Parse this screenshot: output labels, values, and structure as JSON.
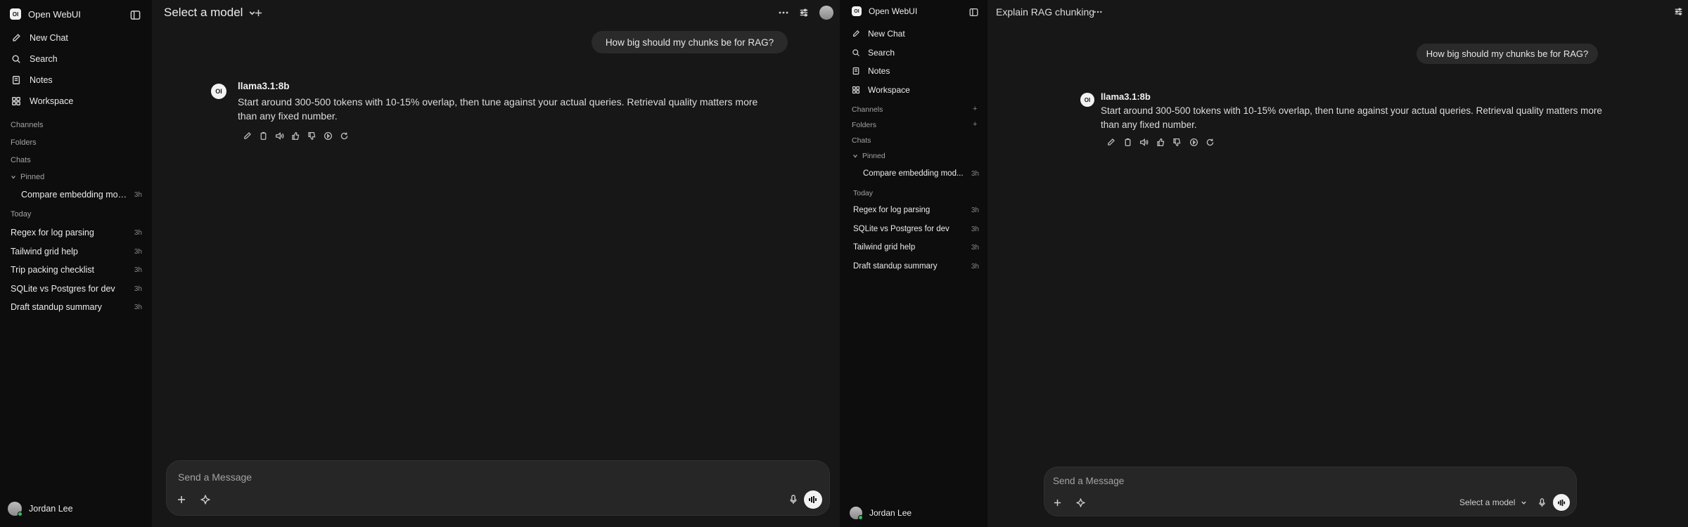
{
  "left": {
    "sidebar": {
      "app_name": "Open WebUI",
      "logo_text": "OI",
      "nav": [
        {
          "label": "New Chat",
          "icon": "edit-icon"
        },
        {
          "label": "Search",
          "icon": "search-icon"
        },
        {
          "label": "Notes",
          "icon": "notes-icon"
        },
        {
          "label": "Workspace",
          "icon": "grid-icon"
        }
      ],
      "sections": {
        "channels": "Channels",
        "folders": "Folders",
        "chats": "Chats",
        "pinned": "Pinned",
        "today": "Today"
      },
      "pinned_chats": [
        {
          "title": "Compare embedding mod...",
          "age": "3h"
        }
      ],
      "today_chats": [
        {
          "title": "Regex for log parsing",
          "age": "3h"
        },
        {
          "title": "Tailwind grid help",
          "age": "3h"
        },
        {
          "title": "Trip packing checklist",
          "age": "3h"
        },
        {
          "title": "SQLite vs Postgres for dev",
          "age": "3h"
        },
        {
          "title": "Draft standup summary",
          "age": "3h"
        }
      ],
      "user_name": "Jordan Lee"
    },
    "header": {
      "model_selector": "Select a model"
    },
    "user_message": "How big should my chunks be for RAG?",
    "assistant": {
      "logo_text": "OI",
      "model": "llama3.1:8b",
      "text": "Start around 300-500 tokens with 10-15% overlap, then tune against your actual queries. Retrieval quality matters more than any fixed number."
    },
    "composer": {
      "placeholder": "Send a Message"
    }
  },
  "right": {
    "sidebar": {
      "app_name": "Open WebUI",
      "logo_text": "OI",
      "nav": [
        {
          "label": "New Chat",
          "icon": "edit-icon"
        },
        {
          "label": "Search",
          "icon": "search-icon"
        },
        {
          "label": "Notes",
          "icon": "notes-icon"
        },
        {
          "label": "Workspace",
          "icon": "grid-icon"
        }
      ],
      "sections": {
        "channels": "Channels",
        "folders": "Folders",
        "chats": "Chats",
        "pinned": "Pinned",
        "today": "Today"
      },
      "pinned_chats": [
        {
          "title": "Compare embedding mod...",
          "age": "3h"
        }
      ],
      "today_chats": [
        {
          "title": "Regex for log parsing",
          "age": "3h"
        },
        {
          "title": "SQLite vs Postgres for dev",
          "age": "3h"
        },
        {
          "title": "Tailwind grid help",
          "age": "3h"
        },
        {
          "title": "Draft standup summary",
          "age": "3h"
        }
      ],
      "user_name": "Jordan Lee"
    },
    "header": {
      "chat_title": "Explain RAG chunking"
    },
    "user_message": "How big should my chunks be for RAG?",
    "assistant": {
      "logo_text": "OI",
      "model": "llama3.1:8b",
      "text": "Start around 300-500 tokens with 10-15% overlap, then tune against your actual queries. Retrieval quality matters more than any fixed number."
    },
    "composer": {
      "placeholder": "Send a Message",
      "model_selector": "Select a model"
    }
  }
}
